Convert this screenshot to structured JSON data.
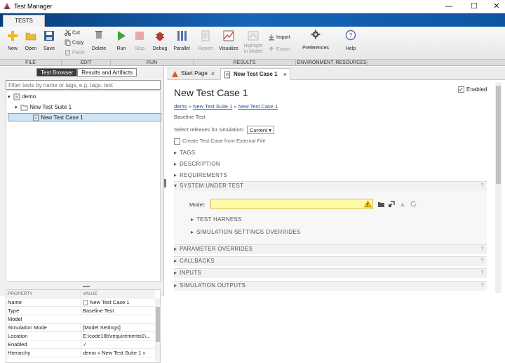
{
  "window": {
    "title": "Test Manager",
    "min": "—",
    "max": "☐",
    "close": "✕"
  },
  "ribbon": {
    "tab": "TESTS",
    "buttons": {
      "new": "New",
      "open": "Open",
      "save": "Save",
      "cut": "Cut",
      "copy": "Copy",
      "paste": "Paste",
      "delete": "Delete",
      "run": "Run",
      "stop": "Stop",
      "debug": "Debug",
      "parallel": "Parallel",
      "report": "Report",
      "visualize": "Visualize",
      "highlight": "Highlight in Model",
      "import": "Import",
      "export": "Export",
      "preferences": "Preferences",
      "help": "Help"
    },
    "groups": {
      "file": "FILE",
      "edit": "EDIT",
      "run": "RUN",
      "results": "RESULTS",
      "environment": "ENVIRONMENT",
      "resources": "RESOURCES"
    }
  },
  "left": {
    "tabs": [
      "Test Browser",
      "Results and Artifacts"
    ],
    "filter_placeholder": "Filter tests by name or tags, e.g. tags: test",
    "tree": [
      "demo",
      "New Test Suite 1",
      "New Test Case 1"
    ],
    "props_header": {
      "key": "PROPERTY",
      "value": "VALUE"
    },
    "props": [
      {
        "key": "Name",
        "value": "New Test Case 1"
      },
      {
        "key": "Type",
        "value": "Baseline Test"
      },
      {
        "key": "Model",
        "value": ""
      },
      {
        "key": "Simulation Mode",
        "value": "[Model Settings]"
      },
      {
        "key": "Location",
        "value": "E:\\code18b\\requirements1\\..."
      },
      {
        "key": "Enabled",
        "value": "✓"
      },
      {
        "key": "Hierarchy",
        "value": "demo » New Test Suite 1 »"
      }
    ]
  },
  "right": {
    "tabs": [
      "Start Page",
      "New Test Case 1"
    ],
    "title": "New Test Case 1",
    "enabled_label": "Enabled",
    "breadcrumb": [
      "demo",
      "New Test Suite 1",
      "New Test Case 1"
    ],
    "breadcrumb_sep": "»",
    "test_type": "Baseline Test",
    "releases_label": "Select releases for simulation:",
    "releases_value": "Current",
    "create_from_file": "Create Test Case from External File",
    "sections": {
      "tags": "TAGS",
      "description": "DESCRIPTION",
      "requirements": "REQUIREMENTS",
      "sut": "SYSTEM UNDER TEST",
      "harness": "TEST HARNESS",
      "sim_overrides": "SIMULATION SETTINGS OVERRIDES",
      "param_overrides": "PARAMETER OVERRIDES",
      "callbacks": "CALLBACKS",
      "inputs": "INPUTS",
      "sim_outputs": "SIMULATION OUTPUTS"
    },
    "model_label": "Model:",
    "model_value": "",
    "help_glyph": "?"
  },
  "colors": {
    "ribbon_blue": "#1565b8",
    "model_field": "#fffaa5",
    "selection": "#cde4f6",
    "link": "#1f4f9c"
  }
}
